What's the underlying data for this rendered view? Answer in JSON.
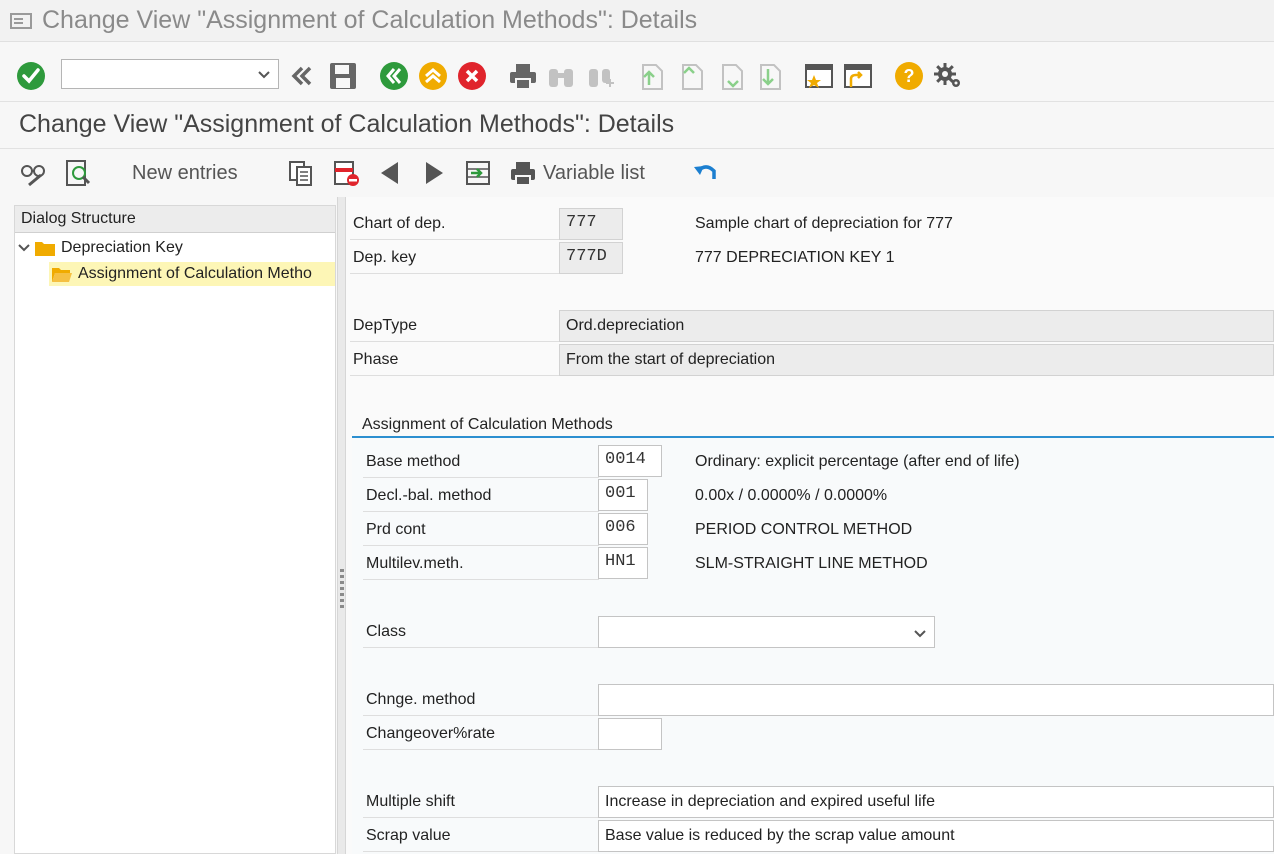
{
  "window": {
    "title": "Change View \"Assignment of Calculation Methods\": Details"
  },
  "toolbar": {
    "command_field_value": "",
    "icons": [
      "enter-icon",
      "back-double-icon",
      "save-icon",
      "back-icon",
      "exit-icon",
      "cancel-icon",
      "print-icon",
      "find-icon",
      "find-next-icon",
      "first-page-icon",
      "previous-page-icon",
      "next-page-icon",
      "last-page-icon",
      "new-session-icon",
      "shortcut-icon",
      "help-icon",
      "settings-icon"
    ]
  },
  "screen": {
    "title": "Change View \"Assignment of Calculation Methods\": Details"
  },
  "app_toolbar": {
    "new_entries": "New entries",
    "variable_list": "Variable list"
  },
  "dialog_structure": {
    "header": "Dialog Structure",
    "items": [
      {
        "label": "Depreciation Key",
        "level": 0,
        "expanded": true
      },
      {
        "label": "Assignment of Calculation Metho",
        "level": 1,
        "selected": true
      }
    ]
  },
  "header_fields": {
    "chart_label": "Chart of dep.",
    "chart_value": "777",
    "chart_desc": "Sample chart of depreciation for 777",
    "key_label": "Dep. key",
    "key_value": "777D",
    "key_desc": "777 DEPRECIATION KEY 1",
    "deptype_label": "DepType",
    "deptype_value": "Ord.depreciation",
    "phase_label": "Phase",
    "phase_value": "From the start of depreciation"
  },
  "group": {
    "title": "Assignment of Calculation Methods",
    "base_label": "Base method",
    "base_value": "0014",
    "base_desc": "Ordinary: explicit percentage (after end of life)",
    "decl_label": "Decl.-bal. method",
    "decl_value": "001",
    "decl_desc": "0.00x / 0.0000% / 0.0000%",
    "prd_label": "Prd cont",
    "prd_value": "006",
    "prd_desc": "PERIOD CONTROL METHOD",
    "multi_label": "Multilev.meth.",
    "multi_value": "HN1",
    "multi_desc": "SLM-STRAIGHT LINE METHOD",
    "class_label": "Class",
    "class_value": "",
    "chnge_label": "Chnge. method",
    "chnge_value": "",
    "changeover_label": "Changeover%rate",
    "changeover_value": "",
    "shift_label": "Multiple shift",
    "shift_value": "Increase in depreciation and expired useful life",
    "scrap_label": "Scrap value",
    "scrap_value": "Base value is reduced by the scrap value amount"
  }
}
